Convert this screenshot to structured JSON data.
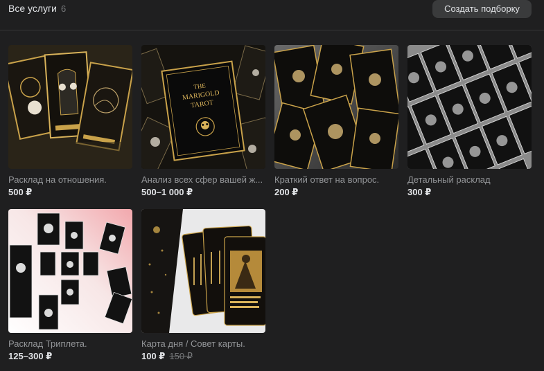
{
  "header": {
    "title": "Все услуги",
    "count": "6",
    "create_button": "Создать подборку"
  },
  "services": [
    {
      "title": "Расклад на отношения.",
      "price": "500 ₽"
    },
    {
      "title": "Анализ всех сфер вашей ж...",
      "price": "500–1 000 ₽"
    },
    {
      "title": "Краткий ответ на вопрос.",
      "price": "200 ₽"
    },
    {
      "title": "Детальный расклад",
      "price": "300 ₽"
    },
    {
      "title": "Расклад Триплета.",
      "price": "125–300 ₽"
    },
    {
      "title": "Карта дня / Совет карты.",
      "price": "100 ₽",
      "old_price": "150 ₽"
    }
  ],
  "artwork": {
    "deck_title_line1": "THE",
    "deck_title_line2": "MARIGOLD",
    "deck_title_line3": "TAROT"
  },
  "colors": {
    "background": "#1f1f20",
    "button": "#3a3b3c",
    "gold": "#c9a24a",
    "muted_text": "#939598"
  }
}
